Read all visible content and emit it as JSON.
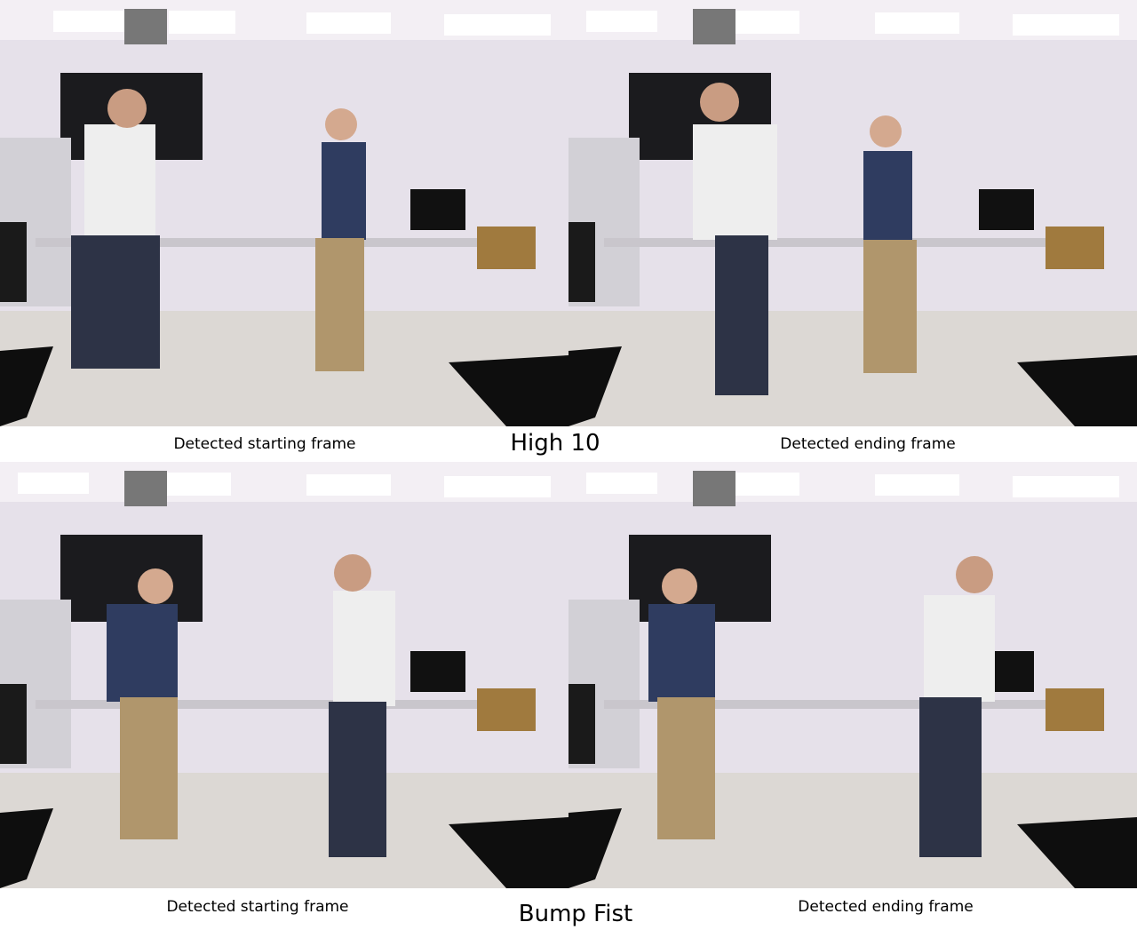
{
  "figure": {
    "rows": [
      {
        "action_label": "High 10",
        "left_caption": "Detected starting frame",
        "right_caption": "Detected ending frame"
      },
      {
        "action_label": "Bump Fist",
        "left_caption": "Detected starting frame",
        "right_caption": "Detected ending frame"
      }
    ]
  }
}
